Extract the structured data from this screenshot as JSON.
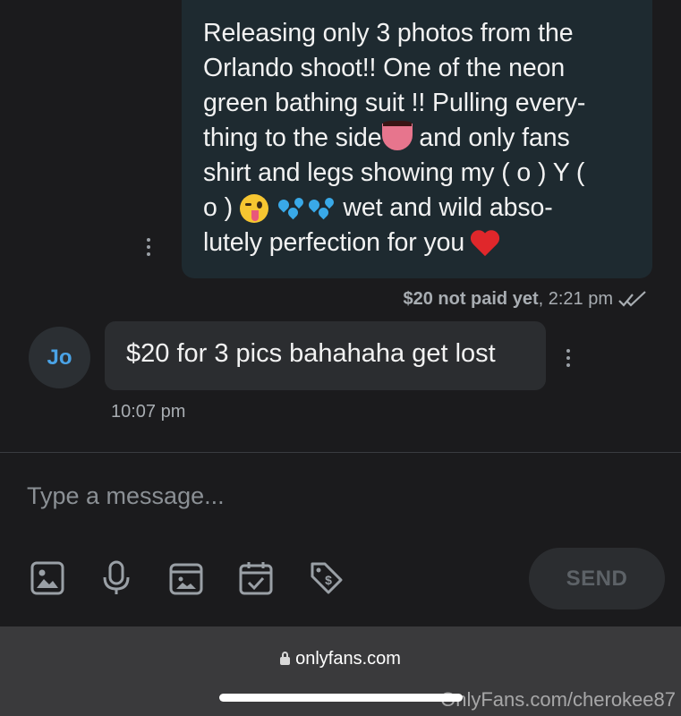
{
  "conversation": {
    "outgoing": {
      "lines": [
        {
          "text": "Releasing only 3 photos from the"
        },
        {
          "text": "Orlando shoot!! One of the neon"
        },
        {
          "text": "green bathing suit !! Pulling every-"
        },
        {
          "pre": "thing to the side",
          "emoji": "tongue-emoji",
          "post": " and only fans"
        },
        {
          "text": "shirt and legs showing my ( o ) Y ("
        },
        {
          "pre": "o ) ",
          "emojis": [
            "winking-tongue-emoji",
            "sweat-droplets-emoji",
            "sweat-droplets-emoji"
          ],
          "post": " wet and wild abso-"
        },
        {
          "pre": "lutely perfection for you ",
          "emoji": "red-heart-emoji"
        }
      ],
      "status": "$20 not paid yet",
      "time": ", 2:21 pm",
      "status_icon": "double-check-icon"
    },
    "incoming": {
      "avatar_initials": "Jo",
      "text": "$20 for 3 pics bahahaha get lost",
      "time": "10:07 pm"
    }
  },
  "composer": {
    "placeholder": "Type a message...",
    "tools": [
      "image-icon",
      "microphone-icon",
      "vault-icon",
      "calendar-check-icon",
      "price-tag-icon"
    ],
    "send_label": "SEND"
  },
  "browser": {
    "url": "onlyfans.com",
    "watermark": "OnlyFans.com/cherokee87"
  },
  "colors": {
    "outgoing_bubble": "#1e2a30",
    "incoming_bubble": "#2b2d30",
    "avatar_text": "#4aa3e6",
    "background": "#1b1b1d"
  }
}
